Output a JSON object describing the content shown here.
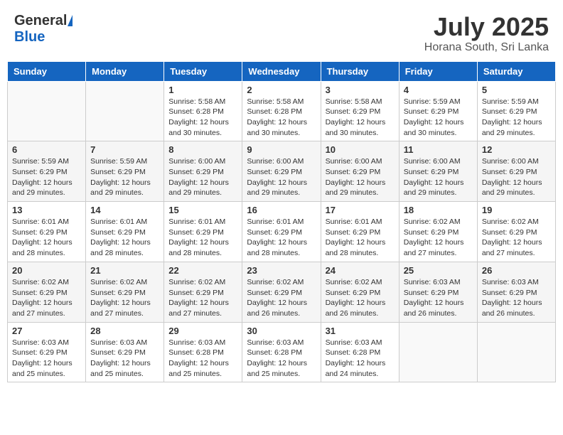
{
  "header": {
    "logo_general": "General",
    "logo_blue": "Blue",
    "month_title": "July 2025",
    "location": "Horana South, Sri Lanka"
  },
  "weekdays": [
    "Sunday",
    "Monday",
    "Tuesday",
    "Wednesday",
    "Thursday",
    "Friday",
    "Saturday"
  ],
  "weeks": [
    [
      {
        "day": "",
        "sunrise": "",
        "sunset": "",
        "daylight": ""
      },
      {
        "day": "",
        "sunrise": "",
        "sunset": "",
        "daylight": ""
      },
      {
        "day": "1",
        "sunrise": "Sunrise: 5:58 AM",
        "sunset": "Sunset: 6:28 PM",
        "daylight": "Daylight: 12 hours and 30 minutes."
      },
      {
        "day": "2",
        "sunrise": "Sunrise: 5:58 AM",
        "sunset": "Sunset: 6:28 PM",
        "daylight": "Daylight: 12 hours and 30 minutes."
      },
      {
        "day": "3",
        "sunrise": "Sunrise: 5:58 AM",
        "sunset": "Sunset: 6:29 PM",
        "daylight": "Daylight: 12 hours and 30 minutes."
      },
      {
        "day": "4",
        "sunrise": "Sunrise: 5:59 AM",
        "sunset": "Sunset: 6:29 PM",
        "daylight": "Daylight: 12 hours and 30 minutes."
      },
      {
        "day": "5",
        "sunrise": "Sunrise: 5:59 AM",
        "sunset": "Sunset: 6:29 PM",
        "daylight": "Daylight: 12 hours and 29 minutes."
      }
    ],
    [
      {
        "day": "6",
        "sunrise": "Sunrise: 5:59 AM",
        "sunset": "Sunset: 6:29 PM",
        "daylight": "Daylight: 12 hours and 29 minutes."
      },
      {
        "day": "7",
        "sunrise": "Sunrise: 5:59 AM",
        "sunset": "Sunset: 6:29 PM",
        "daylight": "Daylight: 12 hours and 29 minutes."
      },
      {
        "day": "8",
        "sunrise": "Sunrise: 6:00 AM",
        "sunset": "Sunset: 6:29 PM",
        "daylight": "Daylight: 12 hours and 29 minutes."
      },
      {
        "day": "9",
        "sunrise": "Sunrise: 6:00 AM",
        "sunset": "Sunset: 6:29 PM",
        "daylight": "Daylight: 12 hours and 29 minutes."
      },
      {
        "day": "10",
        "sunrise": "Sunrise: 6:00 AM",
        "sunset": "Sunset: 6:29 PM",
        "daylight": "Daylight: 12 hours and 29 minutes."
      },
      {
        "day": "11",
        "sunrise": "Sunrise: 6:00 AM",
        "sunset": "Sunset: 6:29 PM",
        "daylight": "Daylight: 12 hours and 29 minutes."
      },
      {
        "day": "12",
        "sunrise": "Sunrise: 6:00 AM",
        "sunset": "Sunset: 6:29 PM",
        "daylight": "Daylight: 12 hours and 29 minutes."
      }
    ],
    [
      {
        "day": "13",
        "sunrise": "Sunrise: 6:01 AM",
        "sunset": "Sunset: 6:29 PM",
        "daylight": "Daylight: 12 hours and 28 minutes."
      },
      {
        "day": "14",
        "sunrise": "Sunrise: 6:01 AM",
        "sunset": "Sunset: 6:29 PM",
        "daylight": "Daylight: 12 hours and 28 minutes."
      },
      {
        "day": "15",
        "sunrise": "Sunrise: 6:01 AM",
        "sunset": "Sunset: 6:29 PM",
        "daylight": "Daylight: 12 hours and 28 minutes."
      },
      {
        "day": "16",
        "sunrise": "Sunrise: 6:01 AM",
        "sunset": "Sunset: 6:29 PM",
        "daylight": "Daylight: 12 hours and 28 minutes."
      },
      {
        "day": "17",
        "sunrise": "Sunrise: 6:01 AM",
        "sunset": "Sunset: 6:29 PM",
        "daylight": "Daylight: 12 hours and 28 minutes."
      },
      {
        "day": "18",
        "sunrise": "Sunrise: 6:02 AM",
        "sunset": "Sunset: 6:29 PM",
        "daylight": "Daylight: 12 hours and 27 minutes."
      },
      {
        "day": "19",
        "sunrise": "Sunrise: 6:02 AM",
        "sunset": "Sunset: 6:29 PM",
        "daylight": "Daylight: 12 hours and 27 minutes."
      }
    ],
    [
      {
        "day": "20",
        "sunrise": "Sunrise: 6:02 AM",
        "sunset": "Sunset: 6:29 PM",
        "daylight": "Daylight: 12 hours and 27 minutes."
      },
      {
        "day": "21",
        "sunrise": "Sunrise: 6:02 AM",
        "sunset": "Sunset: 6:29 PM",
        "daylight": "Daylight: 12 hours and 27 minutes."
      },
      {
        "day": "22",
        "sunrise": "Sunrise: 6:02 AM",
        "sunset": "Sunset: 6:29 PM",
        "daylight": "Daylight: 12 hours and 27 minutes."
      },
      {
        "day": "23",
        "sunrise": "Sunrise: 6:02 AM",
        "sunset": "Sunset: 6:29 PM",
        "daylight": "Daylight: 12 hours and 26 minutes."
      },
      {
        "day": "24",
        "sunrise": "Sunrise: 6:02 AM",
        "sunset": "Sunset: 6:29 PM",
        "daylight": "Daylight: 12 hours and 26 minutes."
      },
      {
        "day": "25",
        "sunrise": "Sunrise: 6:03 AM",
        "sunset": "Sunset: 6:29 PM",
        "daylight": "Daylight: 12 hours and 26 minutes."
      },
      {
        "day": "26",
        "sunrise": "Sunrise: 6:03 AM",
        "sunset": "Sunset: 6:29 PM",
        "daylight": "Daylight: 12 hours and 26 minutes."
      }
    ],
    [
      {
        "day": "27",
        "sunrise": "Sunrise: 6:03 AM",
        "sunset": "Sunset: 6:29 PM",
        "daylight": "Daylight: 12 hours and 25 minutes."
      },
      {
        "day": "28",
        "sunrise": "Sunrise: 6:03 AM",
        "sunset": "Sunset: 6:29 PM",
        "daylight": "Daylight: 12 hours and 25 minutes."
      },
      {
        "day": "29",
        "sunrise": "Sunrise: 6:03 AM",
        "sunset": "Sunset: 6:28 PM",
        "daylight": "Daylight: 12 hours and 25 minutes."
      },
      {
        "day": "30",
        "sunrise": "Sunrise: 6:03 AM",
        "sunset": "Sunset: 6:28 PM",
        "daylight": "Daylight: 12 hours and 25 minutes."
      },
      {
        "day": "31",
        "sunrise": "Sunrise: 6:03 AM",
        "sunset": "Sunset: 6:28 PM",
        "daylight": "Daylight: 12 hours and 24 minutes."
      },
      {
        "day": "",
        "sunrise": "",
        "sunset": "",
        "daylight": ""
      },
      {
        "day": "",
        "sunrise": "",
        "sunset": "",
        "daylight": ""
      }
    ]
  ]
}
